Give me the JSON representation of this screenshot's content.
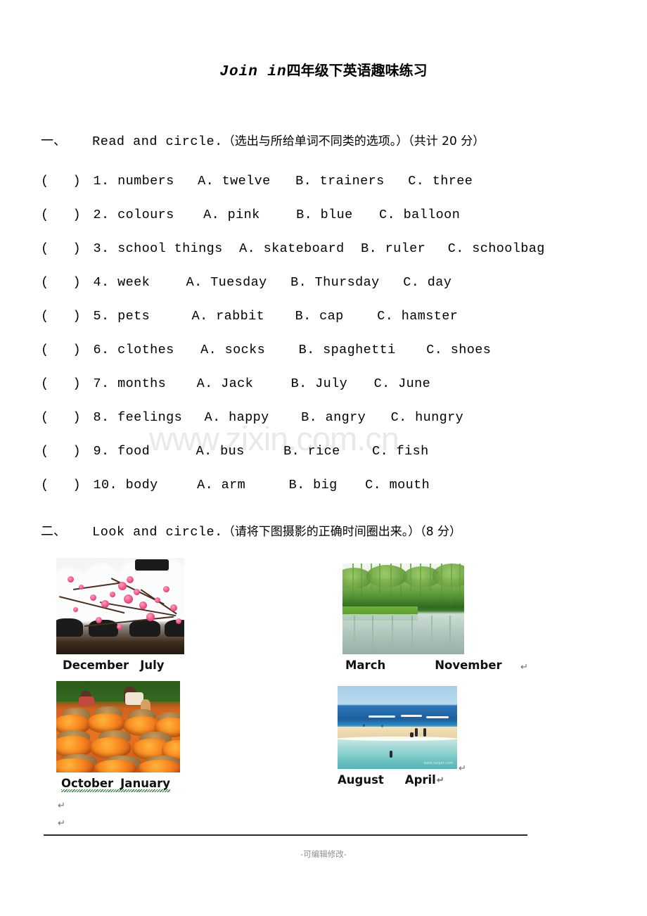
{
  "document": {
    "title_en": "Join in",
    "title_cn": "四年级下英语趣味练习",
    "watermark": "www.zixin.com.cn",
    "footer_note": "-可编辑修改-"
  },
  "section1": {
    "index": "一、",
    "instruction_en": "Read and circle.",
    "instruction_cn": "（选出与所给单词不同类的选项。）",
    "score": "（共计 20 分）",
    "bracket_open": "(",
    "bracket_close": ")",
    "questions": [
      {
        "num": "1.",
        "category": "numbers",
        "a": "A. twelve",
        "b": "B. trainers",
        "c": "C. three"
      },
      {
        "num": "2.",
        "category": "colours",
        "a": "A. pink",
        "b": "B. blue",
        "c": "C. balloon"
      },
      {
        "num": "3.",
        "category": "school things",
        "a": "A. skateboard",
        "b": "B. ruler",
        "c": "C. schoolbag"
      },
      {
        "num": "4.",
        "category": "week",
        "a": "A. Tuesday",
        "b": "B. Thursday",
        "c": "C. day"
      },
      {
        "num": "5.",
        "category": "pets",
        "a": "A. rabbit",
        "b": "B. cap",
        "c": "C. hamster"
      },
      {
        "num": "6.",
        "category": "clothes",
        "a": "A. socks",
        "b": "B. spaghetti",
        "c": "C. shoes"
      },
      {
        "num": "7.",
        "category": "months",
        "a": "A. Jack",
        "b": "B. July",
        "c": "C. June"
      },
      {
        "num": "8.",
        "category": "feelings",
        "a": "A. happy",
        "b": "B. angry",
        "c": "C. hungry"
      },
      {
        "num": "9.",
        "category": "food",
        "a": "A. bus",
        "b": "B. rice",
        "c": "C. fish"
      },
      {
        "num": "10.",
        "category": "body",
        "a": "A. arm",
        "b": "B. big",
        "c": "C. mouth"
      }
    ]
  },
  "section2": {
    "index": "二、",
    "instruction_en": "Look and circle.",
    "instruction_cn": "（请将下图摄影的正确时间圈出来。）",
    "score": "（8 分）",
    "pictures": [
      {
        "photo": "plum-blossom-snow-photo",
        "option_1": "December",
        "option_2": "July"
      },
      {
        "photo": "willow-lake-spring-photo",
        "option_1": "March",
        "option_2": "November"
      },
      {
        "photo": "orange-harvest-photo",
        "option_1": "October",
        "option_2": "January"
      },
      {
        "photo": "beach-summer-sea-photo",
        "option_1": "August",
        "option_2": "April"
      }
    ],
    "paragraph_mark": "↵",
    "beach_watermark": "www.target.com"
  },
  "colors": {
    "text": "#000000",
    "watermark": "#e9e9ec",
    "spellcheck_squiggle": "#2f7a2f",
    "footer_note": "#8e8e8e",
    "rule": "#2b2b2b"
  }
}
